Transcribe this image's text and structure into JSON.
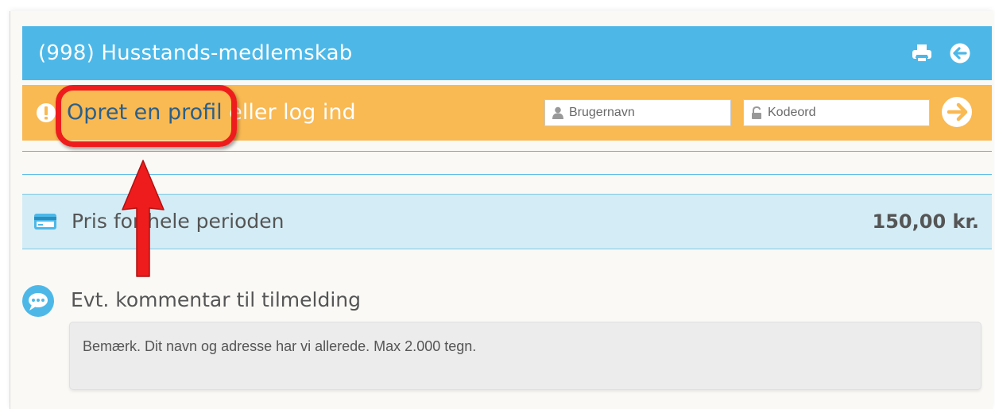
{
  "header": {
    "title": "(998) Husstands-medlemskab",
    "print_icon": "printer-icon",
    "logout_icon": "circle-arrow-left-icon"
  },
  "login": {
    "link_text": "Opret en profil",
    "rest_text": " eller log ind",
    "username_placeholder": "Brugernavn",
    "password_placeholder": "Kodeord",
    "warning_icon": "exclamation-icon",
    "submit_icon": "circle-arrow-right-icon"
  },
  "price": {
    "label": "Pris for hele perioden",
    "value": "150,00 kr.",
    "icon": "credit-card-icon"
  },
  "comment": {
    "label": "Evt. kommentar til tilmelding",
    "placeholder": "Bemærk. Dit navn og adresse har vi allerede. Max 2.000 tegn.",
    "icon": "speech-bubble-icon"
  },
  "annotation": {
    "highlight_color": "#ee1c1c"
  },
  "colors": {
    "header_blue": "#4db8e8",
    "login_orange": "#f9b953",
    "price_blue": "#d4ecf5",
    "link_blue": "#2b5f8a"
  }
}
